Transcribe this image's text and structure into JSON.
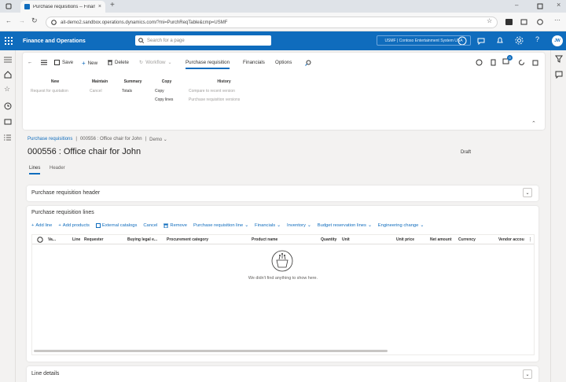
{
  "browser": {
    "tab_title": "Purchase requisitions -- Finan",
    "url": "ait-demo2.sandbox.operations.dynamics.com/?mi=PurchReqTable&cmp=USMF"
  },
  "header": {
    "app_name": "Finance and Operations",
    "search_placeholder": "Search for a page",
    "company": "USMF | Contoso Entertainment System USA",
    "avatar_initials": "JW",
    "notification_count": "",
    "colors": {
      "brand": "#0f6cbd",
      "link": "#0f6cbd"
    }
  },
  "actions": {
    "save": "Save",
    "new": "New",
    "delete": "Delete",
    "workflow": "Workflow",
    "tabs": [
      "Purchase requisition",
      "Financials",
      "Options"
    ],
    "cart_badge": "0"
  },
  "ribbon": {
    "groups": [
      {
        "header": "New",
        "items": [
          {
            "label": "Request for quotation",
            "disabled": true
          }
        ]
      },
      {
        "header": "Maintain",
        "items": [
          {
            "label": "Cancel",
            "disabled": true
          }
        ]
      },
      {
        "header": "Summary",
        "items": [
          {
            "label": "Totals",
            "disabled": false
          }
        ]
      },
      {
        "header": "Copy",
        "items": [
          {
            "label": "Copy",
            "disabled": false
          },
          {
            "label": "Copy lines",
            "disabled": false
          }
        ]
      },
      {
        "header": "History",
        "items": [
          {
            "label": "Compare to recent version",
            "disabled": true
          },
          {
            "label": "Purchase requisition versions",
            "disabled": true
          }
        ]
      }
    ]
  },
  "page": {
    "breadcrumb": [
      "Purchase requisitions",
      "000556 : Office chair for John",
      "Demo"
    ],
    "title": "000556 : Office chair for John",
    "status": "Draft",
    "tabs": {
      "lines": "Lines",
      "header": "Header"
    }
  },
  "sections": {
    "header_title": "Purchase requisition header",
    "lines_title": "Purchase requisition lines",
    "details_title": "Line details"
  },
  "line_toolbar": [
    "Add line",
    "Add products",
    "External catalogs",
    "Cancel",
    "Remove",
    "Purchase requisition line",
    "Financials",
    "Inventory",
    "Budget reservation lines",
    "Engineering change"
  ],
  "grid": {
    "columns": [
      "Va...",
      "Line",
      "Requester",
      "Buying legal e...",
      "Procurement category",
      "Product name",
      "Quantity",
      "Unit",
      "Unit price",
      "Net amount",
      "Currency",
      "Vendor accou"
    ],
    "empty_message": "We didn't find anything to show here."
  }
}
